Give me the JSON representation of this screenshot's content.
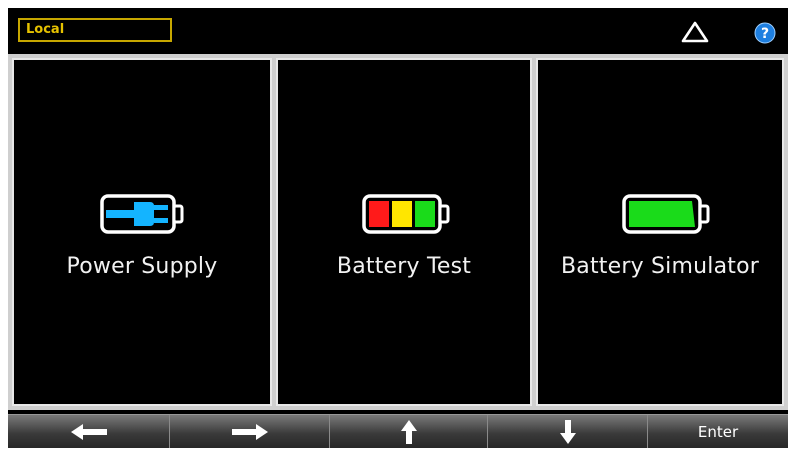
{
  "status_bar": {
    "mode": "Local",
    "warning_icon": "warning-triangle-icon",
    "help_icon": "help-question-icon"
  },
  "panels": [
    {
      "label": "Power Supply",
      "icon": "power-plug-battery-icon"
    },
    {
      "label": "Battery Test",
      "icon": "battery-tricolor-icon"
    },
    {
      "label": "Battery Simulator",
      "icon": "battery-green-icon"
    }
  ],
  "softkeys": {
    "left": "arrow-left-icon",
    "right": "arrow-right-icon",
    "up": "arrow-up-icon",
    "down": "arrow-down-icon",
    "enter_label": "Enter"
  },
  "colors": {
    "mode_border": "#c8a800",
    "plug_blue": "#14b4ff",
    "battery_red": "#ff1a1a",
    "battery_yellow": "#ffe600",
    "battery_green": "#1adb1a",
    "help_blue": "#1e7fe0"
  }
}
